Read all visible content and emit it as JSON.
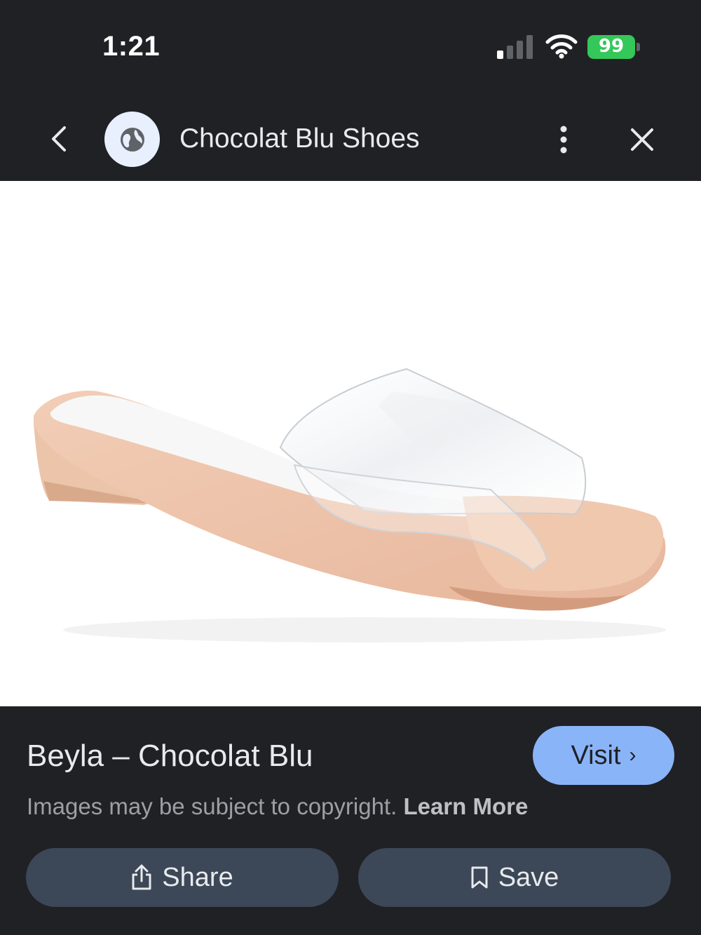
{
  "status_bar": {
    "time": "1:21",
    "battery_percent": "99"
  },
  "top_bar": {
    "site_name": "Chocolat Blu Shoes",
    "back_icon": "chevron-left-icon",
    "favicon_icon": "globe-icon",
    "menu_icon": "more-vert-icon",
    "close_icon": "close-icon"
  },
  "image": {
    "subject": "clear-strap nude slide sandal"
  },
  "result": {
    "title": "Beyla – Chocolat Blu",
    "visit_label": "Visit",
    "copyright_text": "Images may be subject to copyright.",
    "learn_more_label": "Learn More"
  },
  "actions": {
    "share_label": "Share",
    "save_label": "Save"
  },
  "colors": {
    "background": "#202124",
    "accent": "#8ab4f8",
    "button_bg": "#3c4757",
    "battery": "#34c759"
  }
}
